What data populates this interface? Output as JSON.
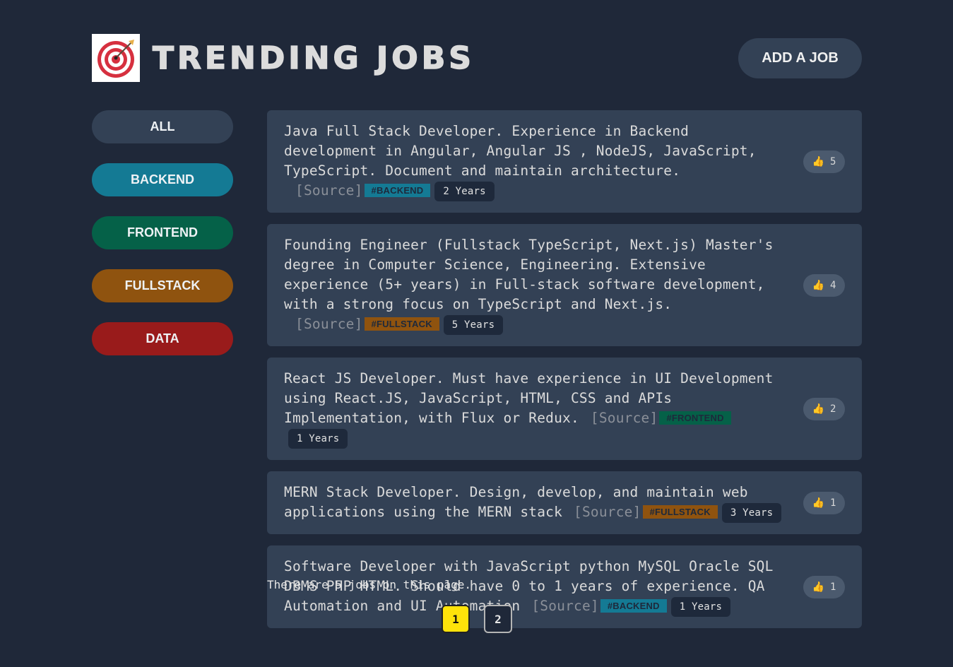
{
  "header": {
    "title": "TRENDING JOBS",
    "add_button": "ADD A JOB",
    "logo_icon": "target-dart-icon"
  },
  "categories": [
    {
      "label": "ALL",
      "color": "#334155"
    },
    {
      "label": "BACKEND",
      "color": "#147a94"
    },
    {
      "label": "FRONTEND",
      "color": "#056148"
    },
    {
      "label": "FULLSTACK",
      "color": "#8f530f"
    },
    {
      "label": "DATA",
      "color": "#991b1b"
    }
  ],
  "jobs": [
    {
      "text": "Java Full Stack Developer. Experience in Backend development in Angular, Angular JS , NodeJS, JavaScript, TypeScript. Document and maintain architecture.",
      "source": "[Source]",
      "tag": "#BACKEND",
      "tag_bg": "#147a94",
      "tag_fg": "#1e293b",
      "years": "2 Years",
      "votes": "5"
    },
    {
      "text": "Founding Engineer (Fullstack TypeScript, Next.js) Master's degree in Computer Science, Engineering. Extensive experience (5+ years) in Full-stack software development, with a strong focus on TypeScript and Next.js.",
      "source": "[Source]",
      "tag": "#FULLSTACK",
      "tag_bg": "#8f530f",
      "tag_fg": "#1e293b",
      "years": "5 Years",
      "votes": "4"
    },
    {
      "text": "React JS Developer. Must have experience in UI Development using React.JS, JavaScript, HTML, CSS and APIs Implementation, with Flux or Redux.",
      "source": "[Source]",
      "tag": "#FRONTEND",
      "tag_bg": "#056148",
      "tag_fg": "#1e293b",
      "years": "1 Years",
      "votes": "2"
    },
    {
      "text": "MERN Stack Developer. Design, develop, and maintain web applications using the MERN stack",
      "source": "[Source]",
      "tag": "#FULLSTACK",
      "tag_bg": "#8f530f",
      "tag_fg": "#1e293b",
      "years": "3 Years",
      "votes": "1"
    },
    {
      "text": "Software Developer with JavaScript python MySQL Oracle SQL DBMS PHP HTML. Should have 0 to 1 years of experience. QA Automation and UI Automation",
      "source": "[Source]",
      "tag": "#BACKEND",
      "tag_bg": "#147a94",
      "tag_fg": "#1e293b",
      "years": "1 Years",
      "votes": "1"
    }
  ],
  "vote_icon": "thumbs-up-icon",
  "footer": {
    "count_text": "There are 5 jobs on this page.",
    "pages": [
      "1",
      "2"
    ],
    "active_page": "1"
  }
}
